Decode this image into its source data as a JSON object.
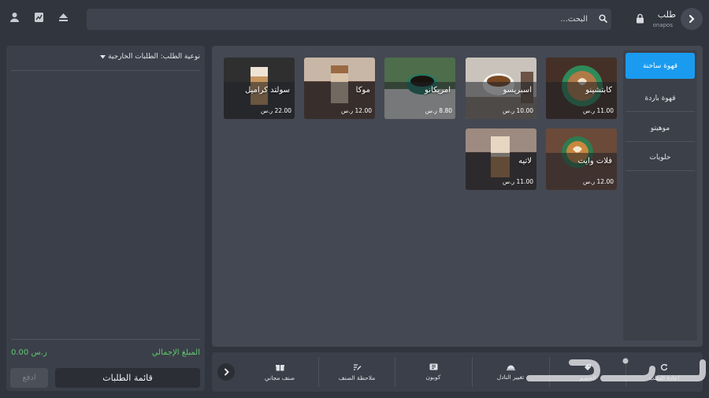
{
  "header": {
    "title": "طلب",
    "subtitle": "onapos",
    "search_placeholder": "البحث..."
  },
  "order_panel": {
    "order_type_label": "نوعية الطلب: الطلبات الخارجية",
    "total_label": "المبلغ الإجمالي",
    "total_value": "0.00 ر.س",
    "orders_list_button": "قائمة الطلبات",
    "pay_button": "ادفع"
  },
  "categories": [
    {
      "label": "قهوة ساخنة",
      "active": true
    },
    {
      "label": "قهوة باردة",
      "active": false
    },
    {
      "label": "موهيتو",
      "active": false
    },
    {
      "label": "حلويات",
      "active": false
    }
  ],
  "products": [
    {
      "name": "كابتشينو",
      "price": "11.00 ر.س"
    },
    {
      "name": "اسبريسو",
      "price": "10.00 ر.س"
    },
    {
      "name": "امريكانو",
      "price": "8.80 ر.س"
    },
    {
      "name": "موكا",
      "price": "12.00 ر.س"
    },
    {
      "name": "سولتد كراميل",
      "price": "22.00 ر.س"
    },
    {
      "name": "فلات وايت",
      "price": "12.00 ر.س"
    },
    {
      "name": "لاتيه",
      "price": "11.00 ر.س"
    }
  ],
  "actions": [
    {
      "label": "اعادة الطلب",
      "icon": "refresh-icon"
    },
    {
      "label": "الخصم",
      "icon": "tag-icon"
    },
    {
      "label": "تغيير النادل",
      "icon": "waiter-bell-icon"
    },
    {
      "label": "كوبون",
      "icon": "coupon-icon"
    },
    {
      "label": "ملاحظة الصنف",
      "icon": "note-edit-icon"
    },
    {
      "label": "صنف مجاني",
      "icon": "gift-icon"
    }
  ],
  "watermark": {
    "text": "حراج"
  },
  "colors": {
    "background": "#31353e",
    "panel": "#3b3f49",
    "catalog": "#444852",
    "accent": "#1a9bf0",
    "total": "#5fc96f"
  }
}
